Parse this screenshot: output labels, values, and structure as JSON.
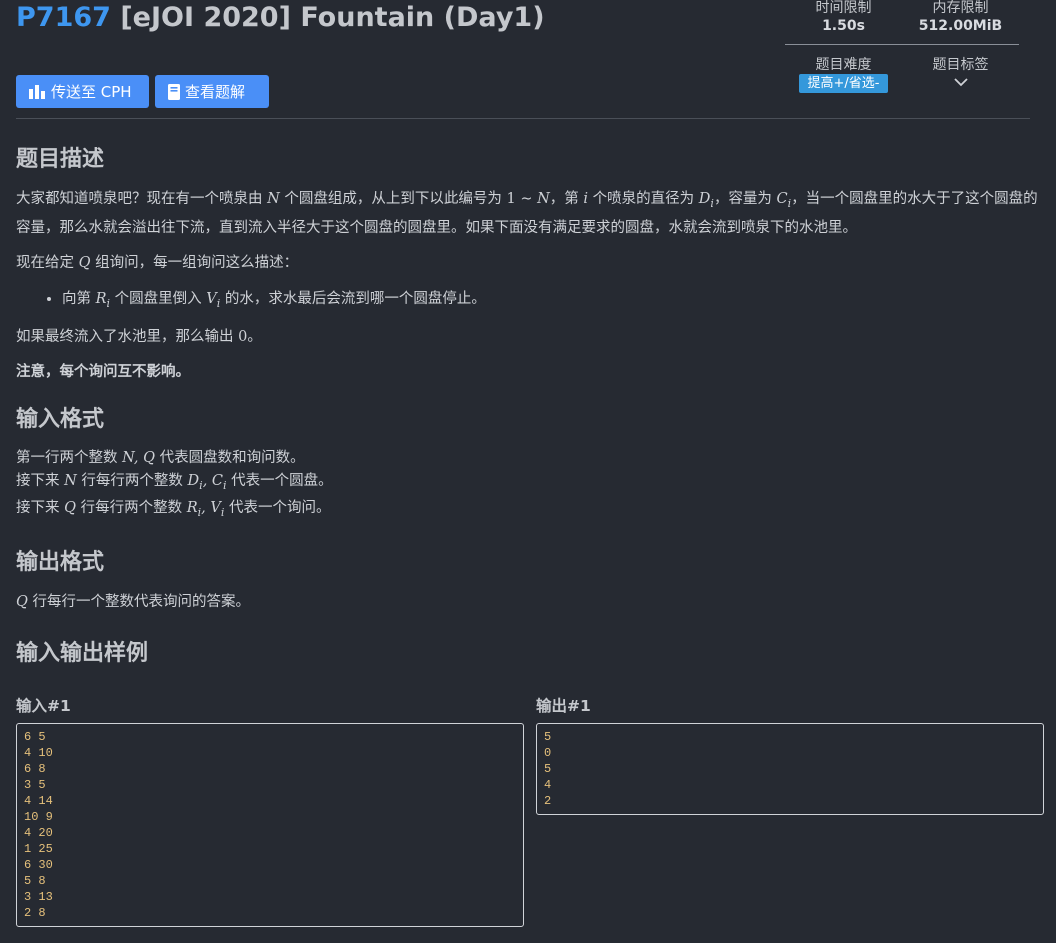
{
  "problem": {
    "pid": "P7167",
    "name": "[eJOI 2020] Fountain (Day1)"
  },
  "buttons": {
    "cph": "传送至 CPH",
    "solution": "查看题解"
  },
  "meta": {
    "time_label": "时间限制",
    "time_value": "1.50s",
    "memory_label": "内存限制",
    "memory_value": "512.00MiB",
    "difficulty_label": "题目难度",
    "difficulty_value": "提高+/省选-",
    "difficulty_color": "#3498db",
    "tags_label": "题目标签"
  },
  "sections": {
    "description_title": "题目描述",
    "input_title": "输入格式",
    "output_title": "输出格式",
    "samples_title": "输入输出样例"
  },
  "description": {
    "p1_a": "大家都知道喷泉吧？现在有一个喷泉由 ",
    "p1_var_n": "N",
    "p1_b": " 个圆盘组成，从上到下以此编号为 ",
    "p1_range": "1 ∼ ",
    "p1_var_n2": "N",
    "p1_c": "，第 ",
    "p1_var_i": "i",
    "p1_d": " 个喷泉的直径为 ",
    "p1_var_d": "D",
    "p1_sub_i1": "i",
    "p1_e": "，容量为 ",
    "p1_var_c": "C",
    "p1_sub_i2": "i",
    "p1_f": "，当一个圆盘里的水大于了这个圆盘的容量，那么水就会溢出往下流，直到流入半径大于这个圆盘的圆盘里。如果下面没有满足要求的圆盘，水就会流到喷泉下的水池里。",
    "p2_a": "现在给定 ",
    "p2_var_q": "Q",
    "p2_b": " 组询问，每一组询问这么描述：",
    "li_a": "向第 ",
    "li_var_r": "R",
    "li_sub_i": "i",
    "li_b": " 个圆盘里倒入 ",
    "li_var_v": "V",
    "li_sub_i2": "i",
    "li_c": " 的水，求水最后会流到哪一个圆盘停止。",
    "p3_a": "如果最终流入了水池里，那么输出 ",
    "p3_zero": "0",
    "p3_b": "。",
    "note": "注意，每个询问互不影响。"
  },
  "input_format": {
    "l1_a": "第一行两个整数 ",
    "l1_vars": "N, Q",
    "l1_b": " 代表圆盘数和询问数。",
    "l2_a": "接下来 ",
    "l2_var": "N",
    "l2_b": " 行每行两个整数 ",
    "l2_d": "D",
    "l2_sub1": "i",
    "l2_sep": ", ",
    "l2_c": "C",
    "l2_sub2": "i",
    "l2_e": " 代表一个圆盘。",
    "l3_a": "接下来 ",
    "l3_var": "Q",
    "l3_b": " 行每行两个整数 ",
    "l3_r": "R",
    "l3_sub1": "i",
    "l3_sep": ", ",
    "l3_v": "V",
    "l3_sub2": "i",
    "l3_e": " 代表一个询问。"
  },
  "output_format": {
    "var_q": "Q",
    "text": " 行每行一个整数代表询问的答案。"
  },
  "samples": {
    "input_title": "输入#1",
    "input": "6 5\n4 10\n6 8\n3 5\n4 14\n10 9\n4 20\n1 25\n6 30\n5 8\n3 13\n2 8",
    "output_title": "输出#1",
    "output": "5\n0\n5\n4\n2"
  }
}
